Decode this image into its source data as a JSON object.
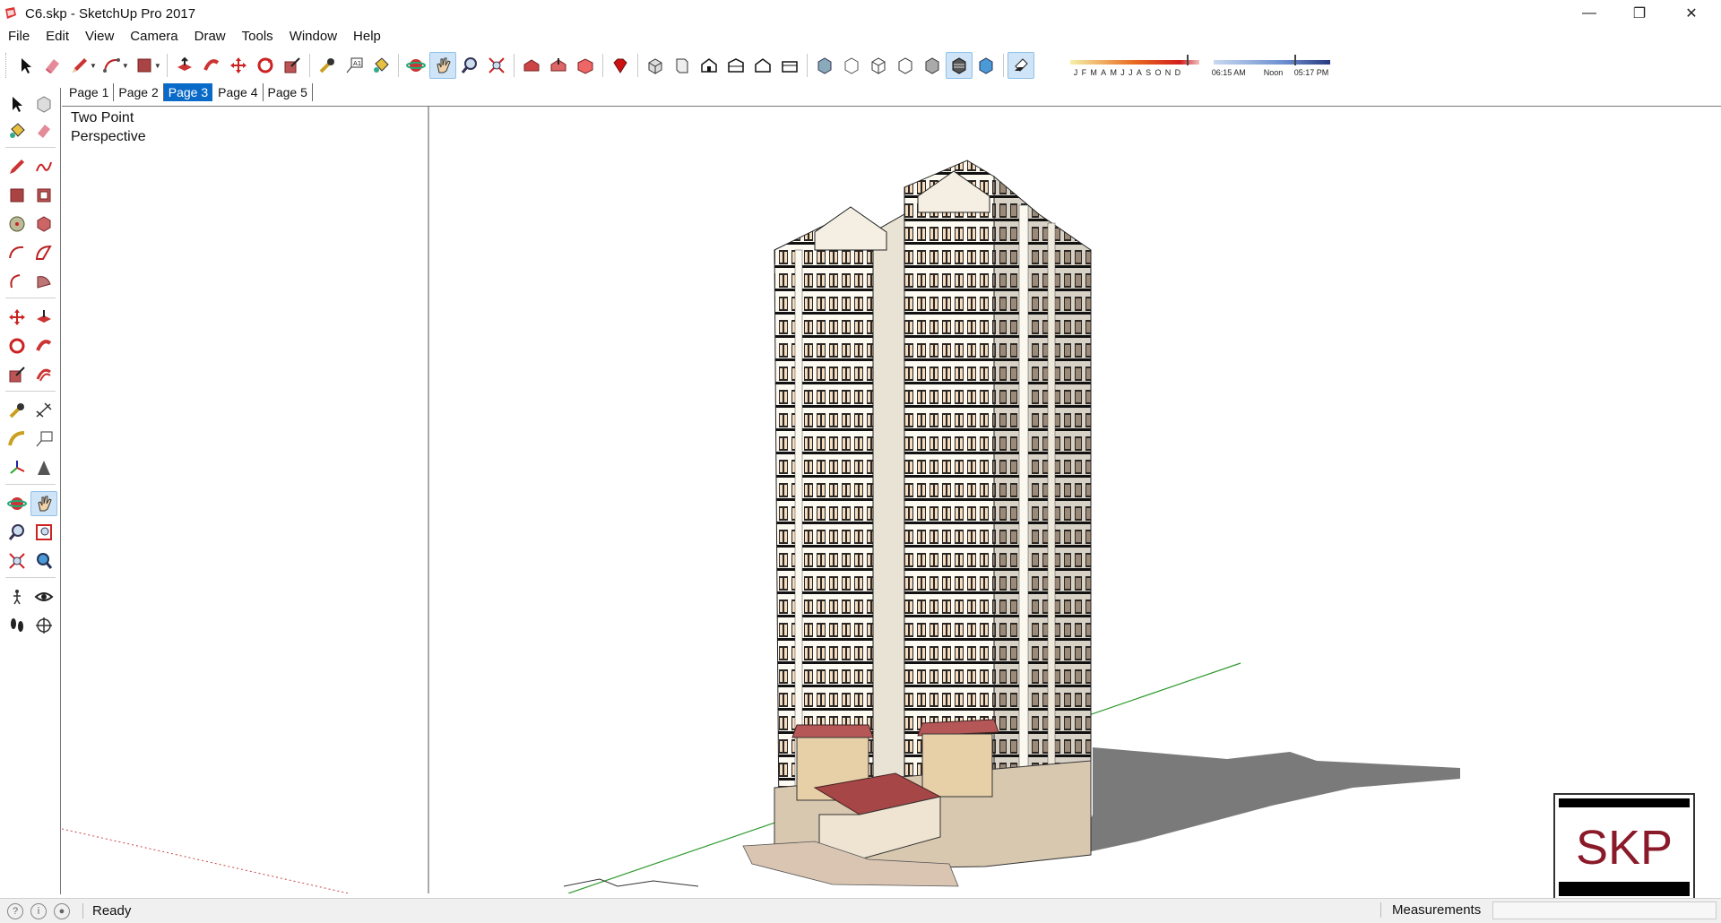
{
  "window": {
    "title": "C6.skp - SketchUp Pro 2017",
    "minimize": "—",
    "restore": "❐",
    "close": "✕"
  },
  "menu": [
    "File",
    "Edit",
    "View",
    "Camera",
    "Draw",
    "Tools",
    "Window",
    "Help"
  ],
  "shadow": {
    "months": "JFMAMJJASOND",
    "time_start": "06:15 AM",
    "time_mid": "Noon",
    "time_end": "05:17 PM"
  },
  "scenes": [
    {
      "label": "Page 1",
      "active": false
    },
    {
      "label": "Page 2",
      "active": false
    },
    {
      "label": "Page 3",
      "active": true
    },
    {
      "label": "Page 4",
      "active": false
    },
    {
      "label": "Page 5",
      "active": false
    }
  ],
  "viewport": {
    "scene_label_line1": "Two Point",
    "scene_label_line2": "Perspective"
  },
  "logo": {
    "text": "SKP"
  },
  "status": {
    "text": "Ready",
    "measurements_label": "Measurements",
    "measurements_value": ""
  },
  "colors": {
    "accent": "#0a6ac8",
    "axis_green": "#2e9a2e",
    "axis_red": "#c44",
    "logo_red": "#8a1a2a"
  }
}
